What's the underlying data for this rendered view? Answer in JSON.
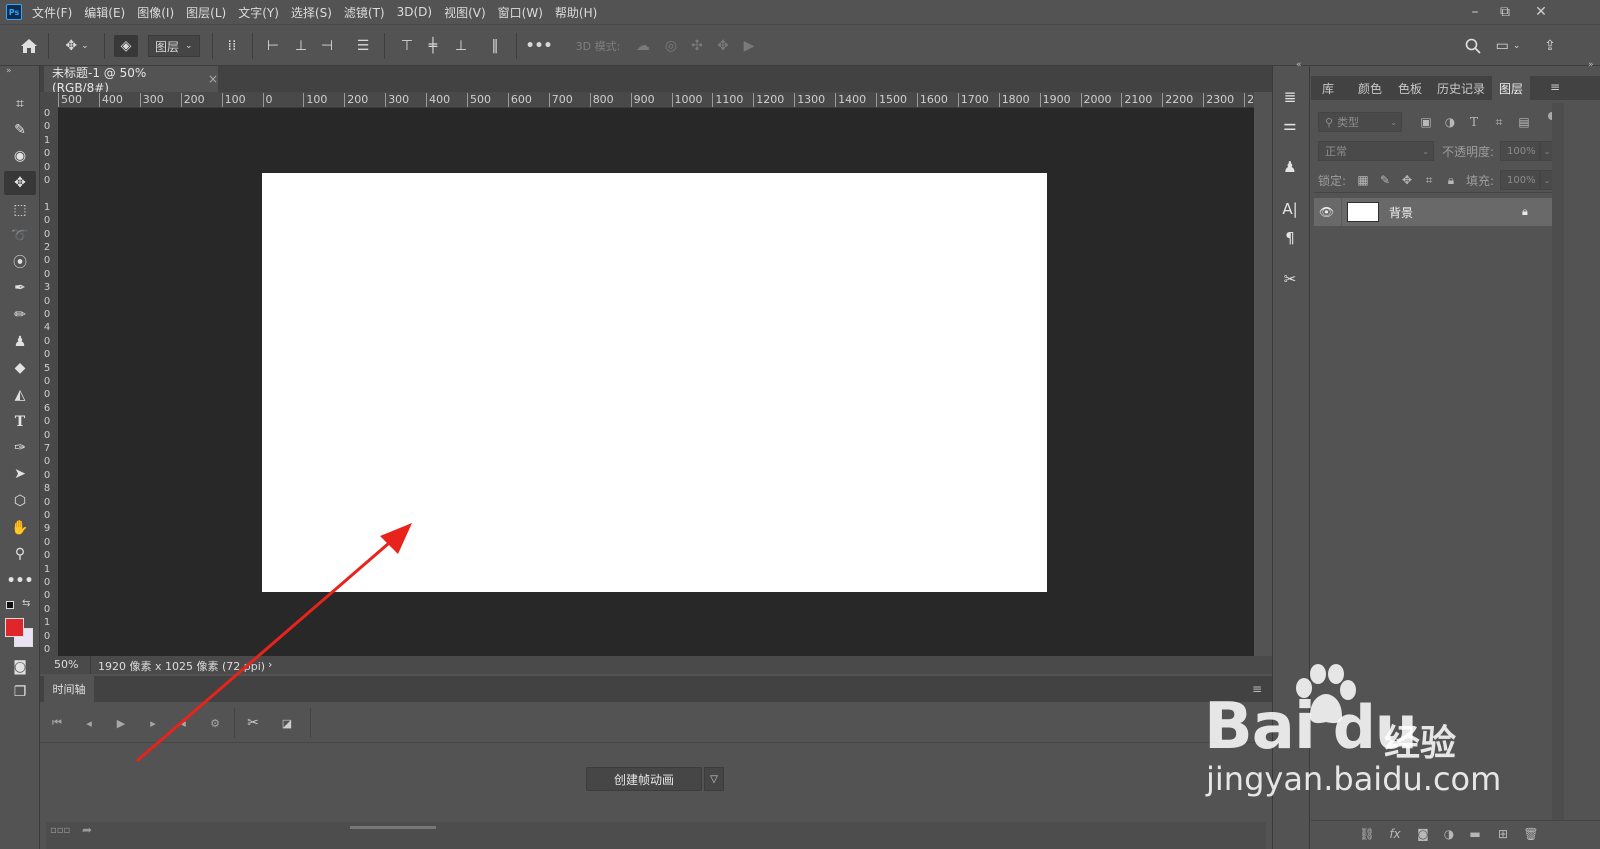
{
  "app": {
    "logo": "Ps"
  },
  "menu": [
    "文件(F)",
    "编辑(E)",
    "图像(I)",
    "图层(L)",
    "文字(Y)",
    "选择(S)",
    "滤镜(T)",
    "3D(D)",
    "视图(V)",
    "窗口(W)",
    "帮助(H)"
  ],
  "window_controls": {
    "minimize": "–",
    "restore": "⧉",
    "close": "✕"
  },
  "options_bar": {
    "home_icon": "home-icon",
    "move_icon": "move-icon",
    "auto_select_value": "图层",
    "mode_label": "3D 模式:"
  },
  "document": {
    "tab_title": "未标题-1 @ 50%(RGB/8#)",
    "tab_close": "×",
    "zoom": "50%",
    "size_info": "1920 像素 x 1025 像素 (72 ppi)",
    "status_arrow": "›"
  },
  "ruler": {
    "top_ticks": [
      "500",
      "400",
      "300",
      "200",
      "100",
      "0",
      "100",
      "200",
      "300",
      "400",
      "500",
      "600",
      "700",
      "800",
      "900",
      "1000",
      "1100",
      "1200",
      "1300",
      "1400",
      "1500",
      "1600",
      "1700",
      "1800",
      "1900",
      "2000",
      "2100",
      "2200",
      "2300",
      "2"
    ],
    "left_ticks": [
      "0",
      "0",
      "1",
      "0",
      "0",
      "0",
      "",
      "1",
      "0",
      "0",
      "2",
      "0",
      "0",
      "3",
      "0",
      "0",
      "4",
      "0",
      "0",
      "5",
      "0",
      "0",
      "6",
      "0",
      "0",
      "7",
      "0",
      "0",
      "8",
      "0",
      "0",
      "9",
      "0",
      "0",
      "1",
      "0",
      "0",
      "0",
      "1",
      "0",
      "0"
    ]
  },
  "timeline": {
    "tab_label": "时间轴",
    "create_button": "创建帧动画",
    "dropdown_icon": "chevron-down-icon"
  },
  "right_panel": {
    "tabs": [
      "库",
      "颜色",
      "色板",
      "历史记录",
      "图层"
    ],
    "active_tab": "图层",
    "filter_placeholder": "类型",
    "blend_mode": "正常",
    "opacity_label": "不透明度:",
    "opacity_value": "100%",
    "lock_label": "锁定:",
    "fill_label": "填充:",
    "fill_value": "100%",
    "layers": [
      {
        "name": "背景",
        "visible": true,
        "locked": true
      }
    ]
  },
  "colors": {
    "foreground": "#e0262b",
    "background": "#e8e4f4",
    "arrow": "#e8231c"
  },
  "watermark": {
    "brand": "Bai du",
    "sub": "经验",
    "url": "jingyan.baidu.com"
  }
}
